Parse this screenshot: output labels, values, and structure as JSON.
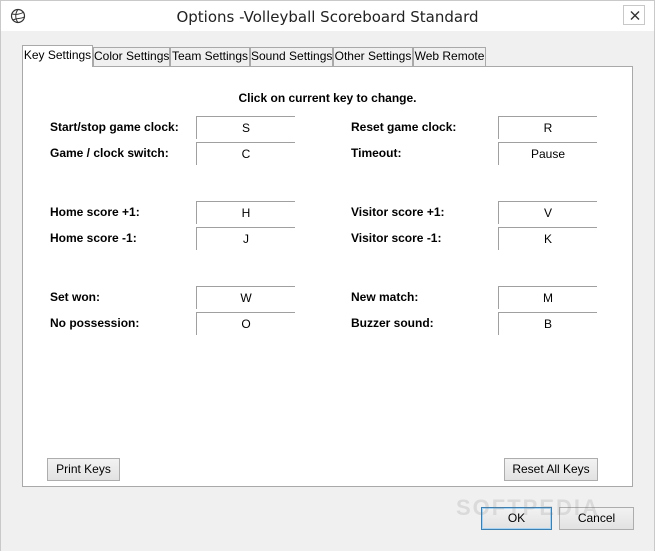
{
  "window": {
    "title": "Options -Volleyball Scoreboard Standard"
  },
  "tabs": [
    {
      "label": "Key Settings",
      "active": true
    },
    {
      "label": "Color Settings",
      "active": false
    },
    {
      "label": "Team Settings",
      "active": false
    },
    {
      "label": "Sound Settings",
      "active": false
    },
    {
      "label": "Other Settings",
      "active": false
    },
    {
      "label": "Web Remote",
      "active": false
    }
  ],
  "key_settings": {
    "instruction": "Click on current key to change.",
    "left": [
      {
        "label": "Start/stop game clock:",
        "key": "S"
      },
      {
        "label": "Game / clock switch:",
        "key": "C"
      },
      {
        "label": "Home score +1:",
        "key": "H"
      },
      {
        "label": "Home score -1:",
        "key": "J"
      },
      {
        "label": "Set won:",
        "key": "W"
      },
      {
        "label": "No possession:",
        "key": "O"
      }
    ],
    "right": [
      {
        "label": "Reset game clock:",
        "key": "R"
      },
      {
        "label": "Timeout:",
        "key": "Pause"
      },
      {
        "label": "Visitor score +1:",
        "key": "V"
      },
      {
        "label": "Visitor score -1:",
        "key": "K"
      },
      {
        "label": "New match:",
        "key": "M"
      },
      {
        "label": "Buzzer sound:",
        "key": "B"
      }
    ],
    "print_keys_label": "Print Keys",
    "reset_all_keys_label": "Reset All Keys"
  },
  "footer": {
    "ok_label": "OK",
    "cancel_label": "Cancel"
  },
  "watermark": "SOFTPEDIA"
}
